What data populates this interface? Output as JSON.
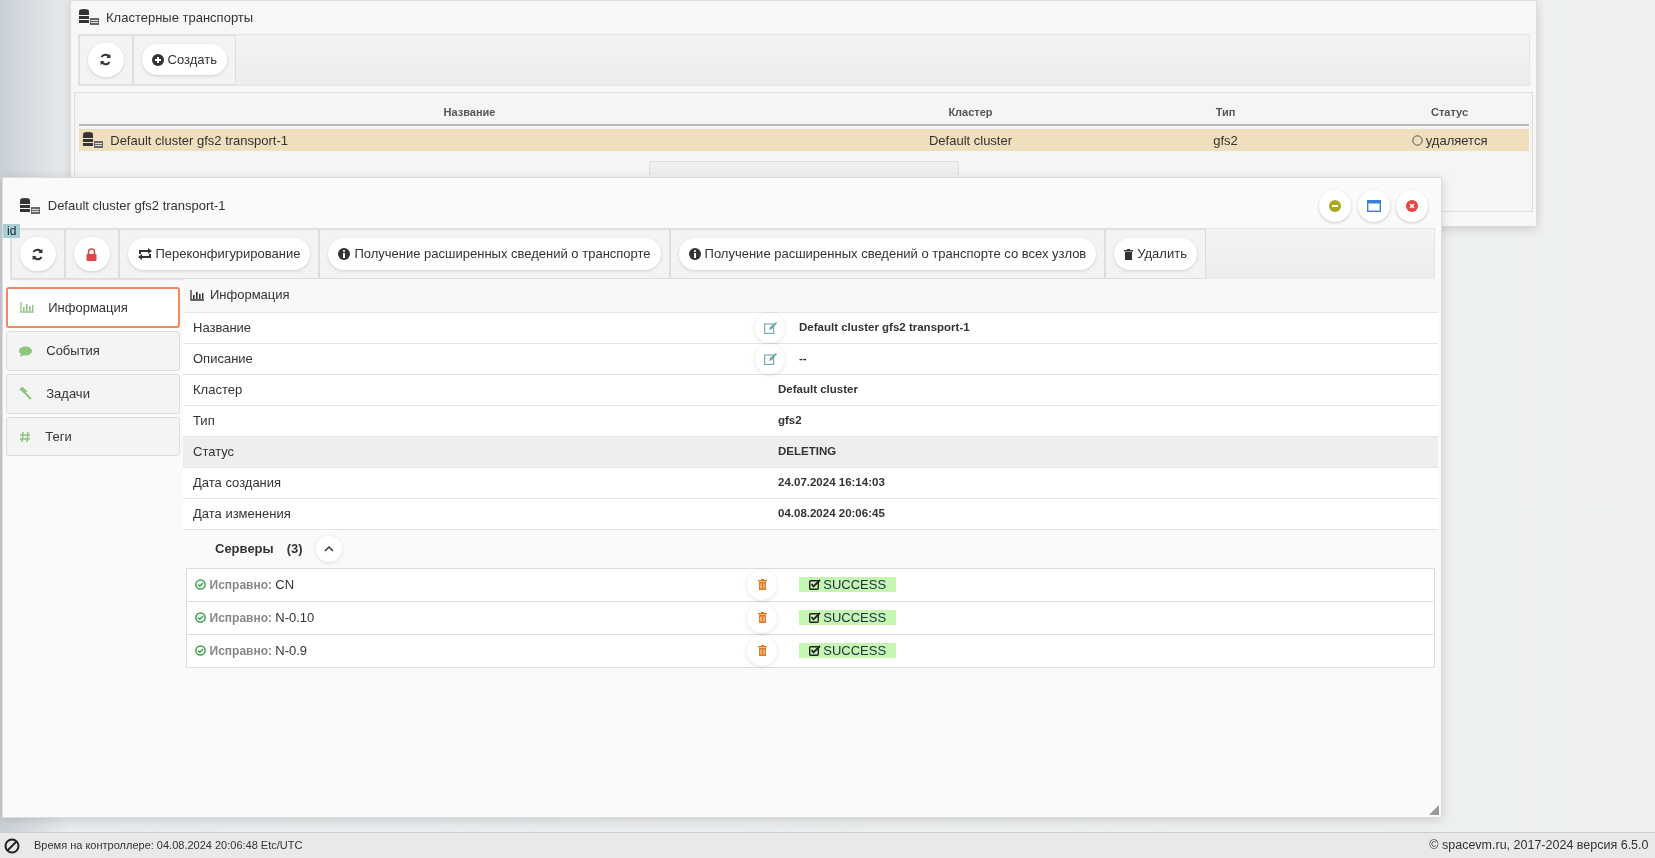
{
  "background_window": {
    "title": "Кластерные транспорты",
    "toolbar_buttons": [
      {
        "kind": "refresh"
      },
      {
        "kind": "create",
        "label": "Создать"
      }
    ],
    "table": {
      "columns": [
        "Название",
        "Кластер",
        "Тип",
        "Статус"
      ],
      "rows": [
        {
          "name": "Default cluster gfs2 transport-1",
          "cluster": "Default cluster",
          "type": "gfs2",
          "status": "удаляется",
          "selected": true
        }
      ]
    }
  },
  "window": {
    "title": "Default cluster gfs2 transport-1",
    "badge": "id",
    "toolbar_buttons": [
      {
        "kind": "refresh"
      },
      {
        "kind": "lock"
      },
      {
        "kind": "reconfigure",
        "label": "Переконфигурирование"
      },
      {
        "kind": "info",
        "label": "Получение расширенных сведений о транспорте"
      },
      {
        "kind": "info",
        "label": "Получение расширенных сведений о транспорте со всех узлов"
      },
      {
        "kind": "delete",
        "label": "Удалить"
      }
    ],
    "sidebar": {
      "items": [
        {
          "kind": "chart",
          "label": "Информация",
          "selected": true
        },
        {
          "kind": "comment",
          "label": "События",
          "selected": false
        },
        {
          "kind": "hammer",
          "label": "Задачи",
          "selected": false
        },
        {
          "kind": "hash",
          "label": "Теги",
          "selected": false
        }
      ]
    },
    "section_title": "Информация",
    "fields": [
      {
        "label": "Название",
        "value": "Default cluster gfs2 transport-1",
        "editable": true,
        "highlighted": false
      },
      {
        "label": "Описание",
        "value": "--",
        "editable": true,
        "highlighted": false
      },
      {
        "label": "Кластер",
        "value": "Default cluster",
        "editable": false,
        "highlighted": false
      },
      {
        "label": "Тип",
        "value": "gfs2",
        "editable": false,
        "highlighted": false
      },
      {
        "label": "Статус",
        "value": "DELETING",
        "editable": false,
        "highlighted": true
      },
      {
        "label": "Дата создания",
        "value": "24.07.2024 16:14:03",
        "editable": false,
        "highlighted": false
      },
      {
        "label": "Дата изменения",
        "value": "04.08.2024 20:06:45",
        "editable": false,
        "highlighted": false
      }
    ],
    "servers": {
      "title": "Серверы",
      "count": "(3)",
      "expanded": true,
      "items": [
        {
          "state": "Исправно:",
          "name": "CN",
          "status": "SUCCESS"
        },
        {
          "state": "Исправно:",
          "name": "N-0.10",
          "status": "SUCCESS"
        },
        {
          "state": "Исправно:",
          "name": "N-0.9",
          "status": "SUCCESS"
        }
      ]
    }
  },
  "status_bar": {
    "time": "Время на контроллере: 04.08.2024 20:06:48 Etc/UTC",
    "copyright": "© spacevm.ru, 2017-2024 версия 6.5.0"
  }
}
